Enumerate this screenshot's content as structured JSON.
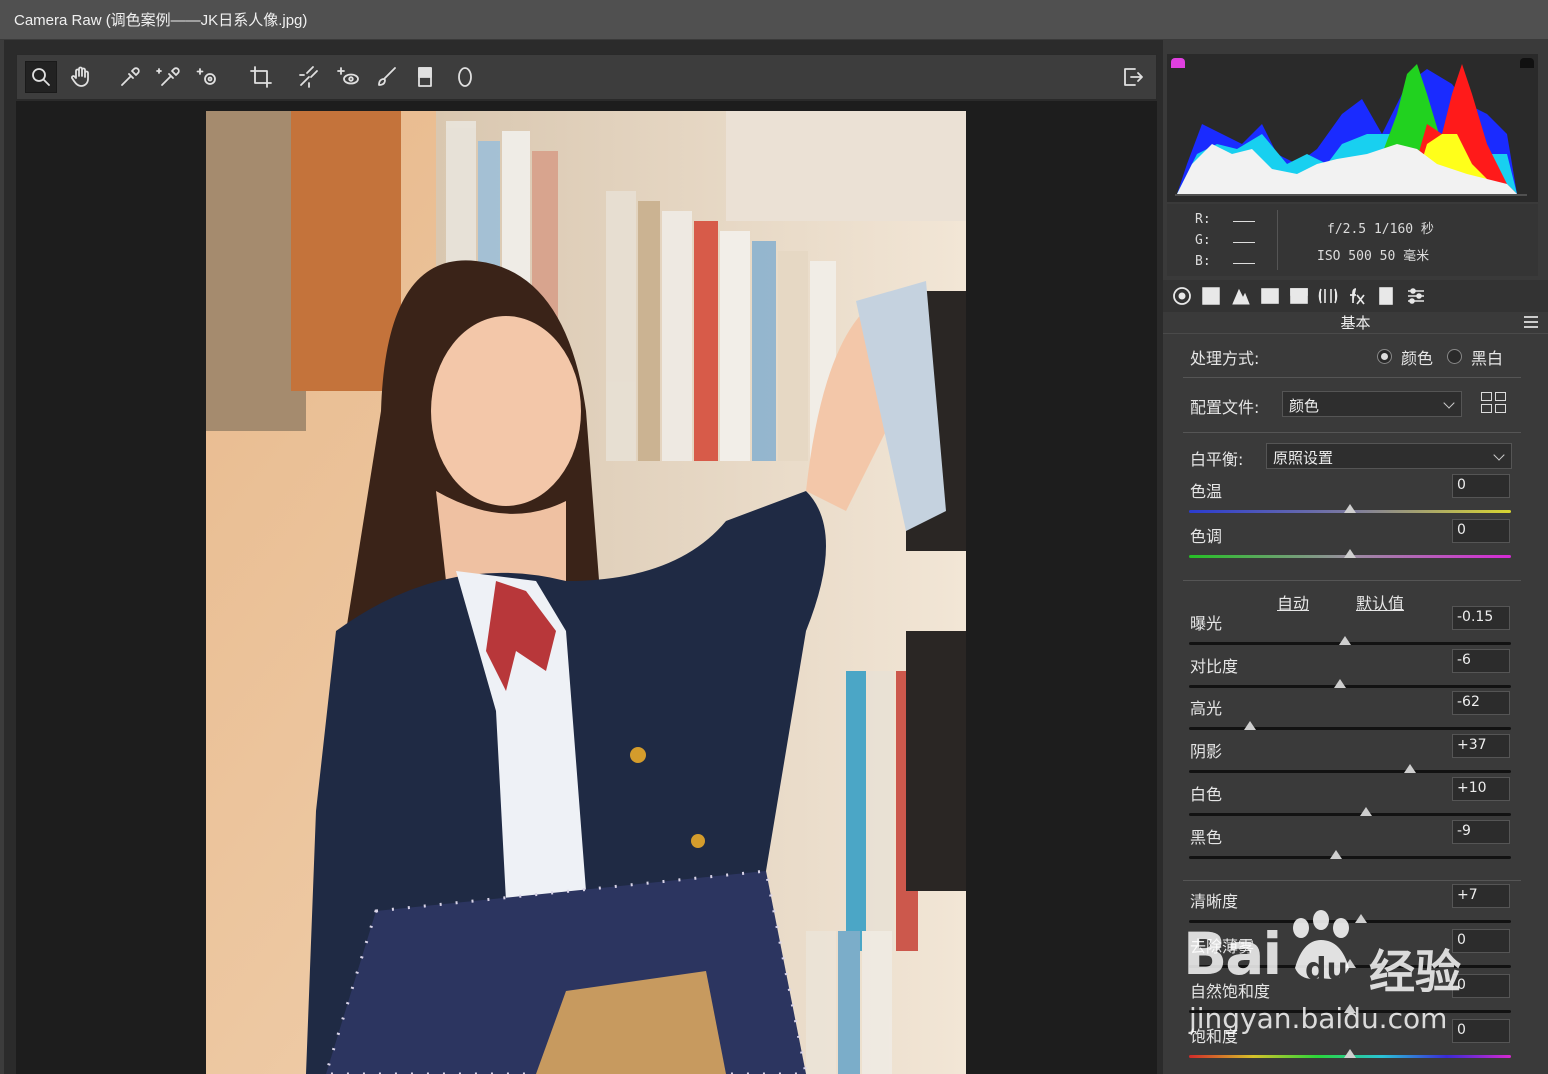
{
  "title": "Camera Raw (调色案例——JK日系人像.jpg)",
  "toolbar": {
    "tools": [
      "zoom-icon",
      "hand-icon",
      "white-balance-icon",
      "color-sampler-icon",
      "targeted-adjust-icon",
      "crop-icon",
      "straighten-icon",
      "spot-removal-icon",
      "red-eye-icon",
      "adjustment-brush-icon",
      "graduated-filter-icon",
      "radial-filter-icon"
    ],
    "export_icon": "open-image-icon"
  },
  "info": {
    "r_label": "R:",
    "g_label": "G:",
    "b_label": "B:",
    "aperture_shutter": "f/2.5   1/160 秒",
    "iso_focal": "ISO 500   50 毫米"
  },
  "panel": {
    "section_title": "基本",
    "treatment_label": "处理方式:",
    "treatment_color": "颜色",
    "treatment_bw": "黑白",
    "profile_label": "配置文件:",
    "profile_value": "颜色",
    "wb_label": "白平衡:",
    "wb_value": "原照设置",
    "auto": "自动",
    "default": "默认值"
  },
  "sliders": [
    {
      "label": "色温",
      "value": "0",
      "pos": 0.5
    },
    {
      "label": "色调",
      "value": "0",
      "pos": 0.5
    },
    {
      "label": "曝光",
      "value": "-0.15",
      "pos": 0.485
    },
    {
      "label": "对比度",
      "value": "-6",
      "pos": 0.47
    },
    {
      "label": "高光",
      "value": "-62",
      "pos": 0.19
    },
    {
      "label": "阴影",
      "value": "+37",
      "pos": 0.685
    },
    {
      "label": "白色",
      "value": "+10",
      "pos": 0.55
    },
    {
      "label": "黑色",
      "value": "-9",
      "pos": 0.455
    },
    {
      "label": "清晰度",
      "value": "+7",
      "pos": 0.535
    },
    {
      "label": "去除薄雾",
      "value": "0",
      "pos": 0.5
    },
    {
      "label": "自然饱和度",
      "value": "0",
      "pos": 0.5
    },
    {
      "label": "饱和度",
      "value": "0",
      "pos": 0.5
    }
  ],
  "watermark": {
    "brand": "Bai",
    "du": "du",
    "cn": "经验",
    "url": "jingyan.baidu.com"
  },
  "colors": {
    "accent_clip_shadow": "#e040e0",
    "panel_bg": "#3a3a3a",
    "canvas_bg": "#1d1d1d"
  }
}
